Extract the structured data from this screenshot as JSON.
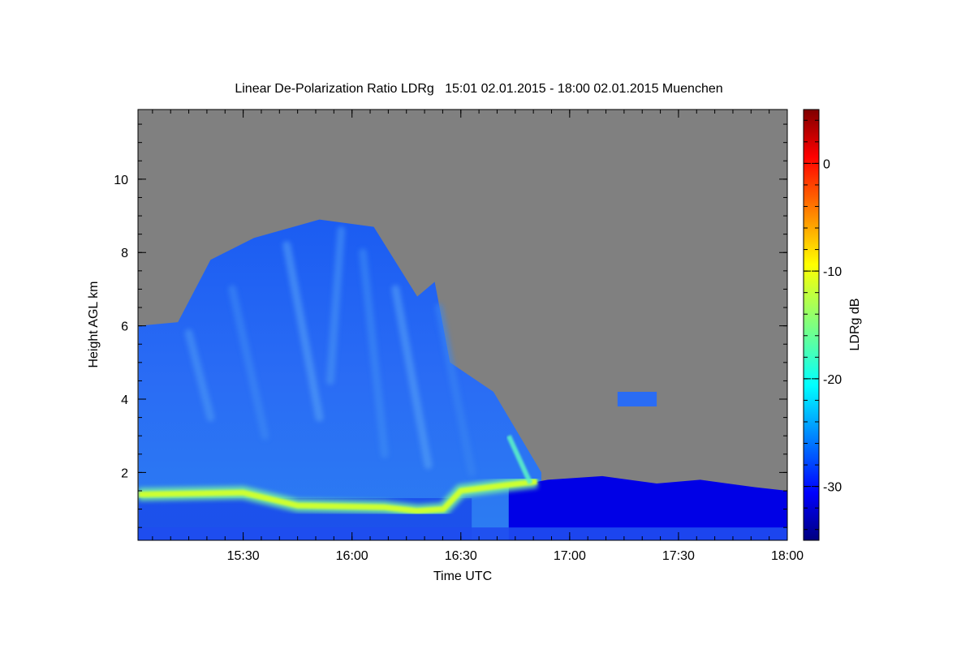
{
  "chart_data": {
    "type": "heatmap",
    "title": "Linear De-Polarization Ratio LDRg   15:01 02.01.2015 - 18:00 02.01.2015 Muenchen",
    "xlabel": "Time UTC",
    "ylabel": "Height AGL km",
    "x_range": [
      "15:01",
      "18:00"
    ],
    "y_range_km": [
      0.15,
      11.9
    ],
    "x_ticks": [
      "15:30",
      "16:00",
      "16:30",
      "17:00",
      "17:30",
      "18:00"
    ],
    "y_ticks": [
      2,
      4,
      6,
      8,
      10
    ],
    "colorbar": {
      "label": "LDRg dB",
      "range": [
        -35,
        5
      ],
      "ticks": [
        -30,
        -20,
        -10,
        0
      ],
      "colormap": "jet"
    },
    "background_color": "#808080",
    "features": [
      {
        "name": "cloud/precipitation region",
        "time_range": [
          "15:01",
          "16:52"
        ],
        "top_height_km": [
          [
            15.02,
            6.0
          ],
          [
            15.2,
            6.1
          ],
          [
            15.35,
            7.8
          ],
          [
            15.55,
            8.4
          ],
          [
            15.85,
            8.9
          ],
          [
            16.1,
            8.7
          ],
          [
            16.3,
            6.8
          ],
          [
            16.38,
            7.2
          ],
          [
            16.45,
            5.0
          ],
          [
            16.65,
            4.2
          ],
          [
            16.87,
            2.0
          ]
        ],
        "ldr_db": -28
      },
      {
        "name": "melting layer bright band",
        "height_km": [
          [
            15.02,
            1.4
          ],
          [
            15.5,
            1.45
          ],
          [
            15.75,
            1.1
          ],
          [
            16.15,
            1.05
          ],
          [
            16.3,
            0.95
          ],
          [
            16.42,
            1.0
          ],
          [
            16.5,
            1.5
          ],
          [
            16.7,
            1.65
          ],
          [
            16.85,
            1.75
          ]
        ],
        "ldr_db": -12
      },
      {
        "name": "low-level boundary layer",
        "time_range": [
          "16:52",
          "18:00"
        ],
        "top_height_km": 1.8,
        "ldr_db": -31
      }
    ]
  }
}
